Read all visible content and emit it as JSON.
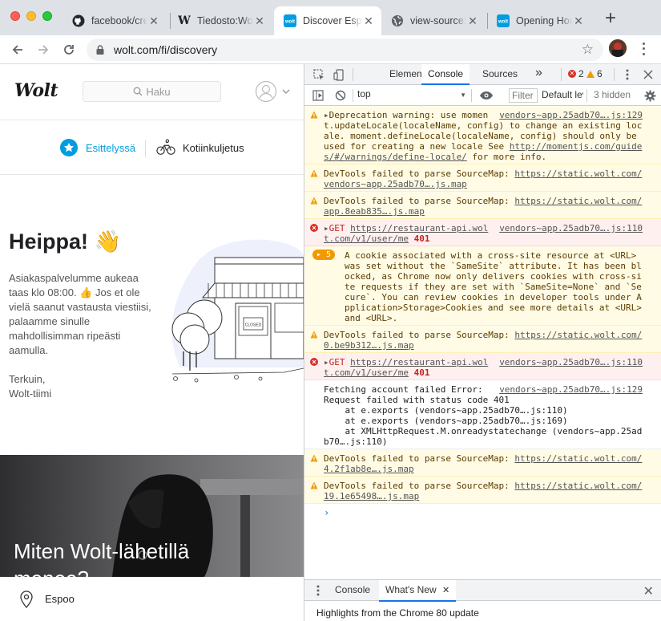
{
  "browser": {
    "tabs": [
      {
        "label": "facebook/create-react-app",
        "icon": "github-icon",
        "active": false
      },
      {
        "label": "Tiedosto:Wolt logo.svg",
        "icon": "wikipedia-icon",
        "active": false
      },
      {
        "label": "Discover Espoo",
        "icon": "wolt-icon",
        "active": true
      },
      {
        "label": "view-source:",
        "icon": "globe-icon",
        "active": false
      },
      {
        "label": "Opening Hours",
        "icon": "wolt-icon",
        "active": false
      }
    ],
    "close_glyph": "✕",
    "new_tab_glyph": "+",
    "url": "wolt.com/fi/discovery"
  },
  "page": {
    "logo": "Wolt",
    "search_placeholder": "Haku",
    "categories": [
      {
        "label": "Esittelyssä",
        "active": true
      },
      {
        "label": "Kotiinkuljetus",
        "active": false
      }
    ],
    "greeting": "Heippa! 👋",
    "message": "Asiakaspalvelumme aukeaa taas klo 08:00. 👍 Jos et ole vielä saanut vastausta viestiisi, palaamme sinulle mahdollisimman ripeästi aamulla.",
    "signature_line1": "Terkuin,",
    "signature_line2": "Wolt-tiimi",
    "closed_sign": "CLOSED",
    "promo_title_line1": "Miten Wolt-lähetillä",
    "promo_title_line2": "menee?",
    "location": "Espoo"
  },
  "devtools": {
    "tabs": [
      "Elements",
      "Console",
      "Sources"
    ],
    "more": "»",
    "error_count": "2",
    "warning_count": "6",
    "context": "top",
    "filter_placeholder": "Filter",
    "levels": "Default levels",
    "hidden": "3 hidden",
    "messages": [
      {
        "level": "warn",
        "expand": true,
        "src": "vendors~app.25adb70….js:129",
        "text": "Deprecation warning: use moment.updateLocale(localeName, config) to change an existing locale. moment.defineLocale(localeName, config) should only be used for creating a new locale See ",
        "link": "http://momentjs.com/guides/#/warnings/define-locale/",
        "tail": " for more info."
      },
      {
        "level": "warn",
        "expand": false,
        "src": "",
        "text": "DevTools failed to parse SourceMap: ",
        "link": "https://static.wolt.com/vendors~app.25adb70….js.map",
        "tail": ""
      },
      {
        "level": "warn",
        "expand": false,
        "src": "",
        "text": "DevTools failed to parse SourceMap: ",
        "link": "https://static.wolt.com/app.8eab835….js.map",
        "tail": ""
      },
      {
        "level": "error",
        "expand": true,
        "src": "vendors~app.25adb70….js:110",
        "text": "GET ",
        "link": "https://restaurant-api.wolt.com/v1/user/me",
        "tail": " 401"
      },
      {
        "level": "warn",
        "expand": false,
        "badge": "5",
        "src": "",
        "text": "A cookie associated with a cross-site resource at <URL> was set without the `SameSite` attribute. It has been blocked, as Chrome now only delivers cookies with cross-site requests if they are set with `SameSite=None` and `Secure`. You can review cookies in developer tools under Application>Storage>Cookies and see more details at <URL> and <URL>.",
        "link": "",
        "tail": ""
      },
      {
        "level": "warn",
        "expand": false,
        "src": "",
        "text": "DevTools failed to parse SourceMap: ",
        "link": "https://static.wolt.com/0.be9b312….js.map",
        "tail": ""
      },
      {
        "level": "error",
        "expand": true,
        "src": "vendors~app.25adb70….js:110",
        "text": "GET ",
        "link": "https://restaurant-api.wolt.com/v1/user/me",
        "tail": " 401"
      },
      {
        "level": "info",
        "expand": false,
        "src": "vendors~app.25adb70….js:129",
        "text": "Fetching account failed Error: Request failed with status code 401\n    at e.exports (vendors~app.25adb70….js:110)\n    at e.exports (vendors~app.25adb70….js:169)\n    at XMLHttpRequest.M.onreadystatechange (vendors~app.25adb70….js:110)",
        "link": "",
        "tail": ""
      },
      {
        "level": "warn",
        "expand": false,
        "src": "",
        "text": "DevTools failed to parse SourceMap: ",
        "link": "https://static.wolt.com/4.2f1ab8e….js.map",
        "tail": ""
      },
      {
        "level": "warn",
        "expand": false,
        "src": "",
        "text": "DevTools failed to parse SourceMap: ",
        "link": "https://static.wolt.com/19.1e65498….js.map",
        "tail": ""
      }
    ],
    "prompt": "›",
    "drawer_tabs": [
      "Console",
      "What's New"
    ],
    "whats_new": "Highlights from the Chrome 80 update"
  }
}
